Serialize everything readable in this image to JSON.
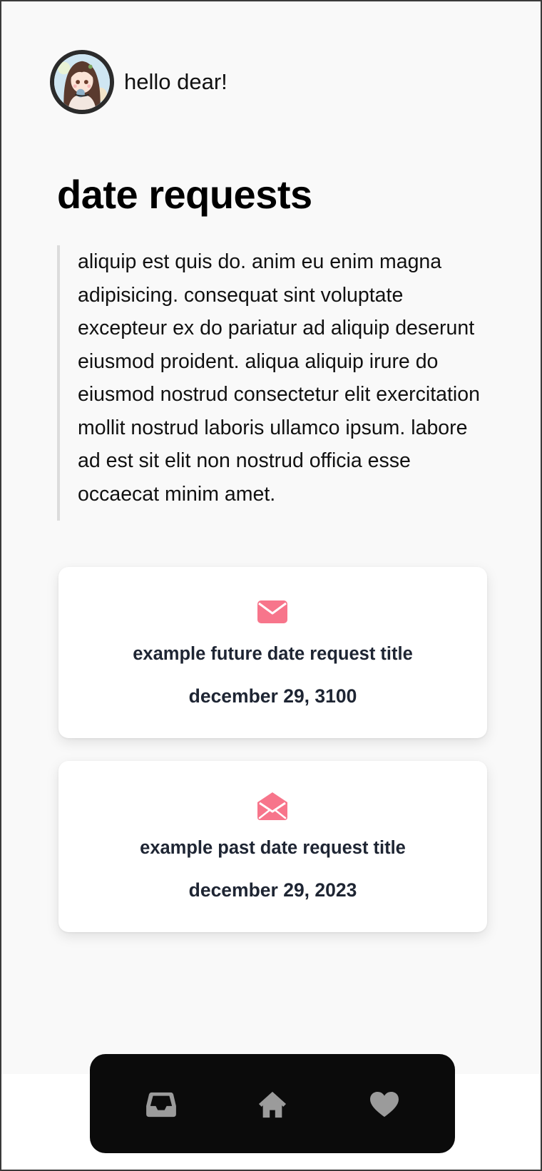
{
  "header": {
    "greeting": "hello dear!",
    "avatar_icon": "avatar-girl-illustration"
  },
  "page": {
    "title": "date requests",
    "intro": "aliquip est quis do. anim eu enim magna adipisicing. consequat sint voluptate excepteur ex do pariatur ad aliquip deserunt eiusmod proident. aliqua aliquip irure do eiusmod nostrud consectetur elit exercitation mollit nostrud laboris ullamco ipsum. labore ad est sit elit non nostrud officia esse occaecat minim amet."
  },
  "requests": [
    {
      "title": "example future date request title",
      "date": "december 29, 3100",
      "icon": "envelope-closed-icon",
      "status": "unopened"
    },
    {
      "title": "example past date request title",
      "date": "december 29, 2023",
      "icon": "envelope-open-icon",
      "status": "opened"
    }
  ],
  "nav": {
    "items": [
      {
        "icon": "inbox-icon"
      },
      {
        "icon": "home-icon"
      },
      {
        "icon": "heart-icon"
      }
    ]
  },
  "colors": {
    "accent": "#f7758b",
    "page_bg": "#f9f9f9",
    "card_text": "#1e2533",
    "nav_bg": "#0b0b0b",
    "nav_icon": "#9b9b9b"
  }
}
